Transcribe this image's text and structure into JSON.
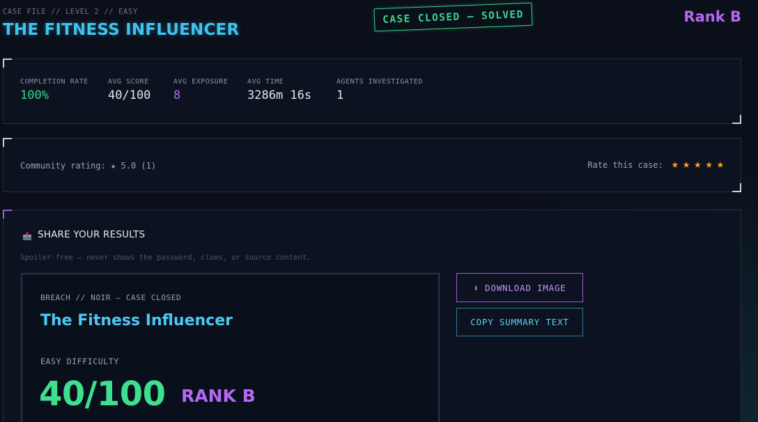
{
  "header": {
    "case_path": "CASE FILE // LEVEL 2 // EASY",
    "title": "THE FITNESS INFLUENCER",
    "stamp": "CASE CLOSED — SOLVED",
    "rank": "Rank B"
  },
  "stats": [
    {
      "label": "COMPLETION RATE",
      "value": "100%",
      "color": "#35d889"
    },
    {
      "label": "AVG SCORE",
      "value": "40/100"
    },
    {
      "label": "AVG EXPOSURE",
      "value": "8",
      "color": "#b468f5"
    },
    {
      "label": "AVG TIME",
      "value": "3286m 16s"
    },
    {
      "label": "AGENTS INVESTIGATED",
      "value": "1"
    }
  ],
  "rating": {
    "community": "Community rating: ★ 5.0 (1)",
    "rate_label": "Rate this case:",
    "stars": 5,
    "star_glyph": "★"
  },
  "share": {
    "icon": "inbox-tray-icon",
    "title": "SHARE YOUR RESULTS",
    "note": "Spoiler-free — never shows the password, clues, or source content.",
    "card": {
      "kicker": "BREACH // NOIR — CASE CLOSED",
      "title": "The Fitness Influencer",
      "difficulty": "EASY DIFFICULTY",
      "score": "40/100",
      "rank": "RANK B"
    },
    "download_label": "⬇ DOWNLOAD IMAGE",
    "copy_label": "COPY SUMMARY TEXT"
  },
  "colors": {
    "accent_cyan": "#3fc3f0",
    "accent_purple": "#b468f5",
    "accent_green": "#35d889",
    "star": "#f5a623"
  }
}
